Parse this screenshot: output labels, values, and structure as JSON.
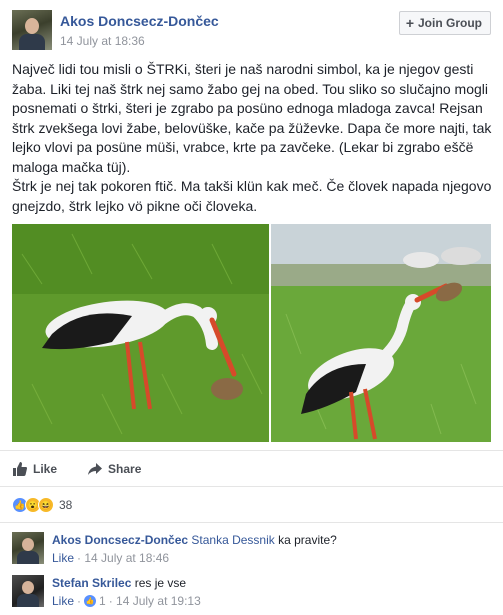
{
  "post": {
    "author": "Akos Doncsecz-Dončec",
    "time": "14 July at 18:36",
    "join_label": "Join Group",
    "paragraphs": [
      "Največ lidi tou misli o ŠTRKi, šteri je naš narodni simbol, ka je njegov gesti žaba. Liki tej naš štrk nej samo žabo gej na obed. Tou sliko so slučajno mogli posnemati o štrki, šteri je zgrabo pa posüno ednoga mladoga zavca! Rejsan štrk zvekšega lovi žabe, belovüške, kače pa žüževke. Dapa če more najti, tak lejko vlovi pa posüne müši, vrabce, krte pa zavčeke. (Lekar bi zgrabo eščë maloga mačka tüj).",
      "Štrk je nej tak pokoren ftič. Ma takši klün kak meč. Če človek napada njegovo gnejzdo, štrk lejko vö pikne oči človeka."
    ]
  },
  "actions": {
    "like": "Like",
    "share": "Share"
  },
  "reactions": {
    "types": [
      "like",
      "wow",
      "haha"
    ],
    "count": "38"
  },
  "comments": [
    {
      "author": "Akos Doncsecz-Dončec",
      "mention": "Stanka Dessnik",
      "text": "ka pravite?",
      "like_label": "Like",
      "meta": "· 14 July at 18:46",
      "reaction_count": ""
    },
    {
      "author": "Stefan Skrilec",
      "mention": "",
      "text": "res je vse",
      "like_label": "Like",
      "meta": "· 14 July at 19:13",
      "reaction_count": "1"
    }
  ],
  "colors": {
    "link": "#365899",
    "muted": "#90949c",
    "like_blue": "#5890ff",
    "grass": "#5f9a2c"
  }
}
